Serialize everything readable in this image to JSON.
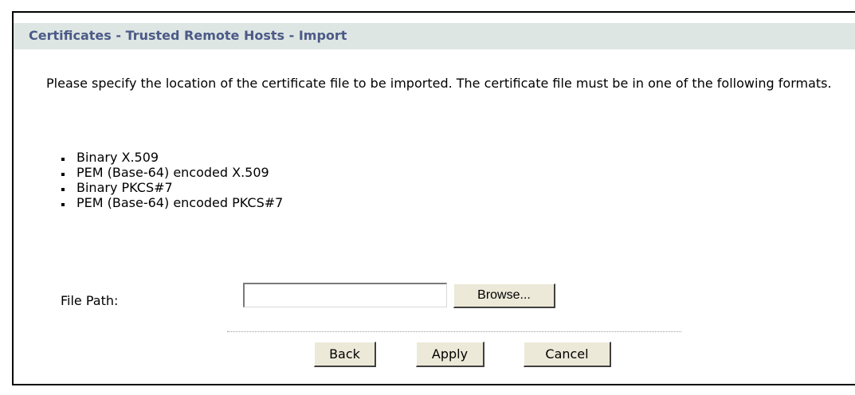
{
  "page": {
    "title": "Certificates - Trusted Remote Hosts - Import",
    "intro": "Please specify the location of the certificate file to be imported. The certificate file must be in one of the following formats.",
    "formats": [
      "Binary X.509",
      "PEM (Base-64) encoded X.509",
      "Binary PKCS#7",
      "PEM (Base-64) encoded PKCS#7"
    ]
  },
  "form": {
    "file_path_label": "File Path:",
    "file_path_value": "",
    "browse_label": "Browse..."
  },
  "actions": {
    "back_label": "Back",
    "apply_label": "Apply",
    "cancel_label": "Cancel"
  },
  "colors": {
    "title_bar_bg": "#dde6e2",
    "title_text": "#4c5a88",
    "button_face": "#ece9d8"
  }
}
